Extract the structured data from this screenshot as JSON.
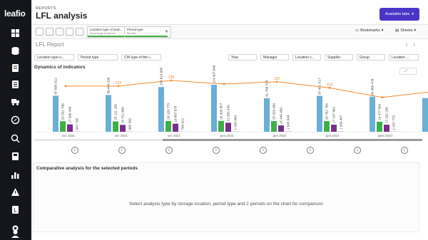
{
  "app": {
    "logo": "leafio",
    "section": "REPORTS",
    "title": "LFL analysis",
    "available_tabs_label": "Available tabs"
  },
  "sidebar": {
    "icons": [
      "dashboard-icon",
      "database-icon",
      "document-icon",
      "list-icon",
      "delivery-icon",
      "compass-icon",
      "search-chart-icon",
      "report-icon",
      "bar-chart-icon",
      "alert-icon",
      "book-icon",
      "settings-icon",
      "user-icon"
    ]
  },
  "selections": {
    "chips": [
      {
        "label": "Location type of anal...",
        "value": "All storage locations"
      },
      {
        "label": "Period type",
        "value": "Months"
      }
    ],
    "bookmarks_label": "Bookmarks",
    "sheets_label": "Sheets"
  },
  "sheet": {
    "title": "LFL Report",
    "filters": [
      "Location type o...",
      "Period type",
      "CW type of the i...",
      "Year",
      "Manager",
      "Location c...",
      "Supplier",
      "Group",
      "Location ..."
    ]
  },
  "chart": {
    "title": "Dynamics of indicators",
    "expand_label": "⤢ ⋯"
  },
  "chart_data": {
    "type": "bar",
    "categories": [
      "окт 2021",
      "окт 2021",
      "окт 2021",
      "дек 2022",
      "дек 2022",
      "дек 2024",
      "фев 2024",
      "дек 2024"
    ],
    "x_tick_labels": [
      "окт 2021",
      "окт 2021",
      "окт 2021",
      "дек 2022",
      "дек 2022",
      "дек 2024",
      "фев 2024",
      "дек 2024"
    ],
    "series": [
      {
        "values": [
          87805512,
          89484256,
          108814665,
          114407848,
          81799709,
          87481517,
          85469478,
          82000000
        ],
        "labels": [
          "87 805 512",
          "89 484 256",
          "108 814 665",
          "114 407 848",
          "81 799 709",
          "87 481 517",
          "85 469 478",
          ""
        ],
        "color": "#6baed6"
      },
      {
        "values": [
          25531798,
          25111189,
          26100773,
          26490857,
          25920490,
          25761784,
          24477564,
          23000000
        ],
        "labels": [
          "25 531 798",
          "25 111 189",
          "26 100 773",
          "26 490 857",
          "25 920 490",
          "25 761 784",
          "24 477 564",
          ""
        ],
        "color": "#3cb043"
      },
      {
        "values": [
          17996436,
          16751880,
          19687879,
          21955430,
          15445489,
          17157463,
          17232290,
          16000000
        ],
        "labels": [
          "17 996 436",
          "16 751 880",
          "19 687 879",
          "21 955 430",
          "15 445 489",
          "17 157 463",
          "17 232 290",
          ""
        ],
        "color": "#7b2d8e"
      },
      {
        "values": [
          947795,
          985382,
          790922,
          1000983,
          1545649,
          1659457,
          1037775,
          900000
        ],
        "labels": [
          "947 795",
          "985 382",
          "790 922",
          "1 000 983",
          "1 545 649",
          "1 659 457",
          "1 037 775",
          ""
        ],
        "color": "#c5c5c5"
      }
    ],
    "line": {
      "values": [
        122,
        122,
        135,
        127,
        132,
        118,
        96,
        110
      ],
      "labels": [
        "",
        "122",
        "135",
        "",
        "132",
        "118",
        "",
        ""
      ],
      "color": "#f58a2c"
    },
    "ylim": [
      0,
      130000000
    ]
  },
  "info_count": 8,
  "comparison": {
    "title": "Comparative analysis for the selected periods",
    "message": "Select analysis type by storage location, period type and 2 periods on the chart for comparison"
  }
}
